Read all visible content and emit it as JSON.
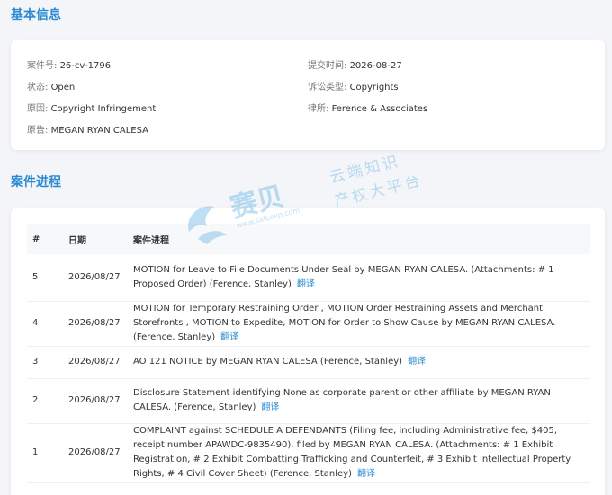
{
  "sections": {
    "basic_title": "基本信息",
    "progress_title": "案件进程"
  },
  "basic_info": {
    "case_no": {
      "label": "案件号:",
      "value": "26-cv-1796"
    },
    "submit_time": {
      "label": "提交时间:",
      "value": "2026-08-27"
    },
    "status": {
      "label": "状态:",
      "value": "Open"
    },
    "lawsuit_type": {
      "label": "诉讼类型:",
      "value": "Copyrights"
    },
    "cause": {
      "label": "原因:",
      "value": "Copyright Infringement"
    },
    "law_firm": {
      "label": "律所:",
      "value": "Ference & Associates"
    },
    "plaintiff": {
      "label": "原告:",
      "value": "MEGAN RYAN CALESA"
    }
  },
  "progress_table": {
    "headers": [
      "#",
      "日期",
      "案件进程"
    ],
    "translate_label": "翻译",
    "rows": [
      {
        "num": "5",
        "date": "2026/08/27",
        "text": "MOTION for Leave to File Documents Under Seal by MEGAN RYAN CALESA. (Attachments: # 1 Proposed Order) (Ference, Stanley)"
      },
      {
        "num": "4",
        "date": "2026/08/27",
        "text": "MOTION for Temporary Restraining Order , MOTION Order Restraining Assets and Merchant Storefronts , MOTION to Expedite, MOTION for Order to Show Cause by MEGAN RYAN CALESA. (Ference, Stanley)"
      },
      {
        "num": "3",
        "date": "2026/08/27",
        "text": "AO 121 NOTICE by MEGAN RYAN CALESA (Ference, Stanley)"
      },
      {
        "num": "2",
        "date": "2026/08/27",
        "text": "Disclosure Statement identifying None as corporate parent or other affiliate by MEGAN RYAN CALESA. (Ference, Stanley)"
      },
      {
        "num": "1",
        "date": "2026/08/27",
        "text": "COMPLAINT against SCHEDULE A DEFENDANTS (Filing fee, including Administrative fee, $405, receipt number APAWDC-9835490), filed by MEGAN RYAN CALESA. (Attachments: # 1 Exhibit Registration, # 2 Exhibit Combatting Trafficking and Counterfeit, # 3 Exhibit Intellectual Property Rights, # 4 Civil Cover Sheet) (Ference, Stanley)"
      }
    ]
  },
  "watermark": {
    "brand": "赛贝",
    "url": "www.saibeiip.com",
    "slogan_line1": "云端知识",
    "slogan_line2": "产权大平台"
  },
  "colors": {
    "accent": "#2a8bd4",
    "background": "#f3f5f8",
    "card": "#ffffff"
  }
}
